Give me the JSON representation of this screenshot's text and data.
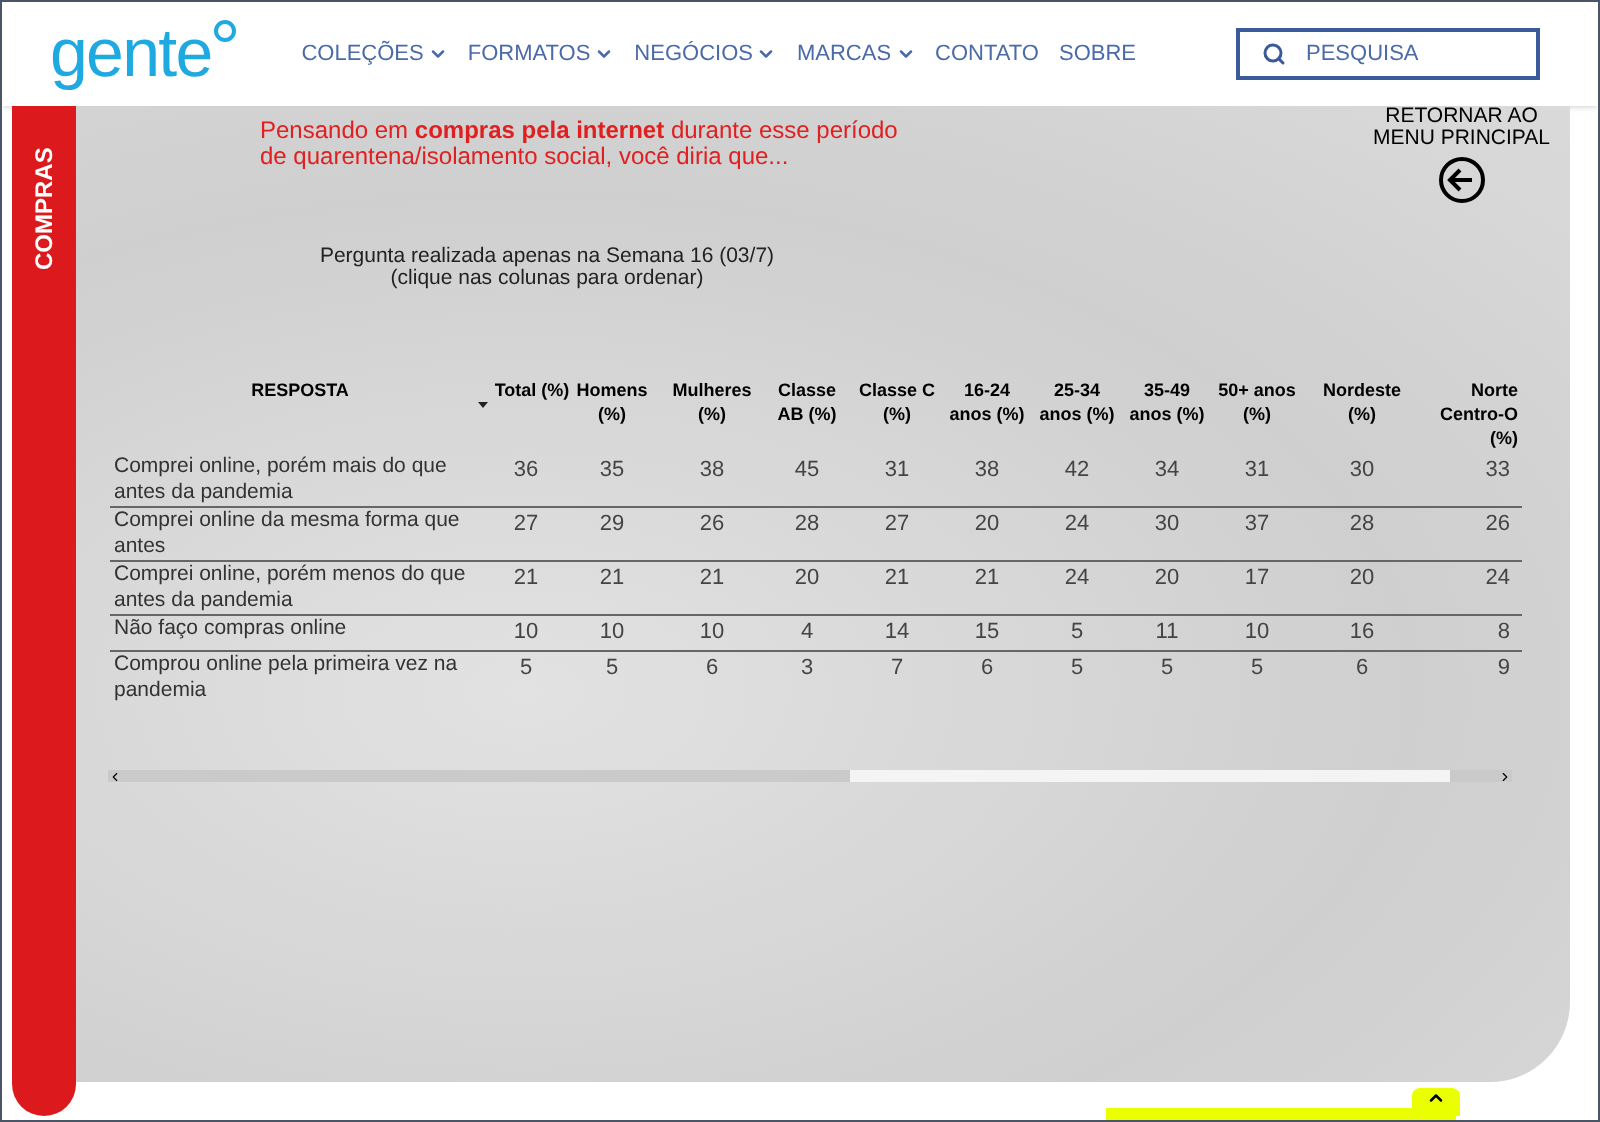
{
  "header": {
    "logo": "gente",
    "nav": [
      {
        "label": "COLEÇÕES",
        "dropdown": true
      },
      {
        "label": "FORMATOS",
        "dropdown": true
      },
      {
        "label": "NEGÓCIOS",
        "dropdown": true
      },
      {
        "label": "MARCAS",
        "dropdown": true
      },
      {
        "label": "CONTATO",
        "dropdown": false
      },
      {
        "label": "SOBRE",
        "dropdown": false
      }
    ],
    "search": {
      "placeholder": "PESQUISA"
    }
  },
  "side_tab": {
    "label": "COMPRAS"
  },
  "question": "Pensando em **compras pela internet** durante esse período de quarentena/isolamento social, você diria que...",
  "back_link": {
    "line_1": "RETORNAR AO",
    "line_2": "MENU PRINCIPAL"
  },
  "note": {
    "line_1": "Pergunta realizada apenas na Semana 16 (03/7)",
    "line_2": "(clique nas colunas para ordenar)"
  },
  "table": {
    "columns": [
      {
        "label": "RESPOSTA",
        "sorted": false
      },
      {
        "label": "Total (%)",
        "sorted": true
      },
      {
        "label": "Homens (%)",
        "sorted": false
      },
      {
        "label": "Mulheres (%)",
        "sorted": false
      },
      {
        "label": "Classe AB (%)",
        "sorted": false
      },
      {
        "label": "Classe C (%)",
        "sorted": false
      },
      {
        "label": "16-24 anos (%)",
        "sorted": false
      },
      {
        "label": "25-34 anos (%)",
        "sorted": false
      },
      {
        "label": "35-49 anos (%)",
        "sorted": false
      },
      {
        "label": "50+ anos (%)",
        "sorted": false
      },
      {
        "label": "Nordeste (%)",
        "sorted": false
      },
      {
        "label": "Norte Centro-O (%)",
        "sorted": false
      }
    ],
    "rows": [
      [
        "Comprei online, porém mais do que antes da pandemia",
        "36",
        "35",
        "38",
        "45",
        "31",
        "38",
        "42",
        "34",
        "31",
        "30",
        "33"
      ],
      [
        "Comprei online da mesma forma que antes",
        "27",
        "29",
        "26",
        "28",
        "27",
        "20",
        "24",
        "30",
        "37",
        "28",
        "26"
      ],
      [
        "Comprei online, porém menos do que antes da pandemia",
        "21",
        "21",
        "21",
        "20",
        "21",
        "21",
        "24",
        "20",
        "17",
        "20",
        "24"
      ],
      [
        "Não faço compras online",
        "10",
        "10",
        "10",
        "4",
        "14",
        "15",
        "5",
        "11",
        "10",
        "16",
        "8"
      ],
      [
        "Comprou online pela primeira vez na pandemia",
        "5",
        "5",
        "6",
        "3",
        "7",
        "6",
        "5",
        "5",
        "5",
        "6",
        "9"
      ]
    ]
  }
}
